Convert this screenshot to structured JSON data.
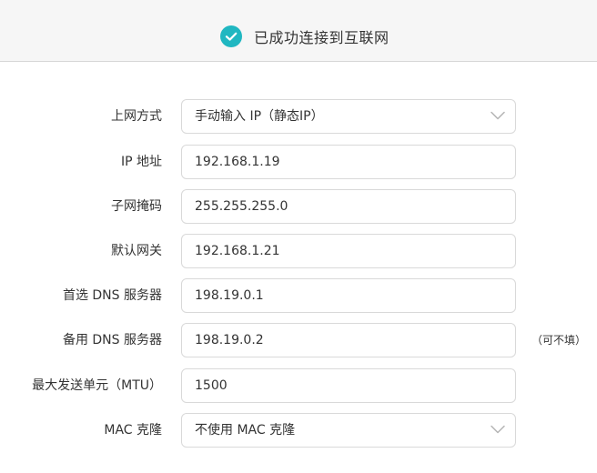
{
  "status": {
    "message": "已成功连接到互联网",
    "icon": "check-circle-icon",
    "icon_color": "#20b7c1"
  },
  "form": {
    "connection_type": {
      "label": "上网方式",
      "value": "手动输入 IP（静态IP）"
    },
    "ip_address": {
      "label": "IP 地址",
      "value": "192.168.1.19"
    },
    "subnet_mask": {
      "label": "子网掩码",
      "value": "255.255.255.0"
    },
    "default_gateway": {
      "label": "默认网关",
      "value": "192.168.1.21"
    },
    "primary_dns": {
      "label": "首选 DNS 服务器",
      "value": "198.19.0.1"
    },
    "secondary_dns": {
      "label": "备用 DNS 服务器",
      "value": "198.19.0.2",
      "hint": "（可不填）"
    },
    "mtu": {
      "label": "最大发送单元（MTU）",
      "value": "1500"
    },
    "mac_clone": {
      "label": "MAC 克隆",
      "value": "不使用 MAC 克隆"
    }
  }
}
